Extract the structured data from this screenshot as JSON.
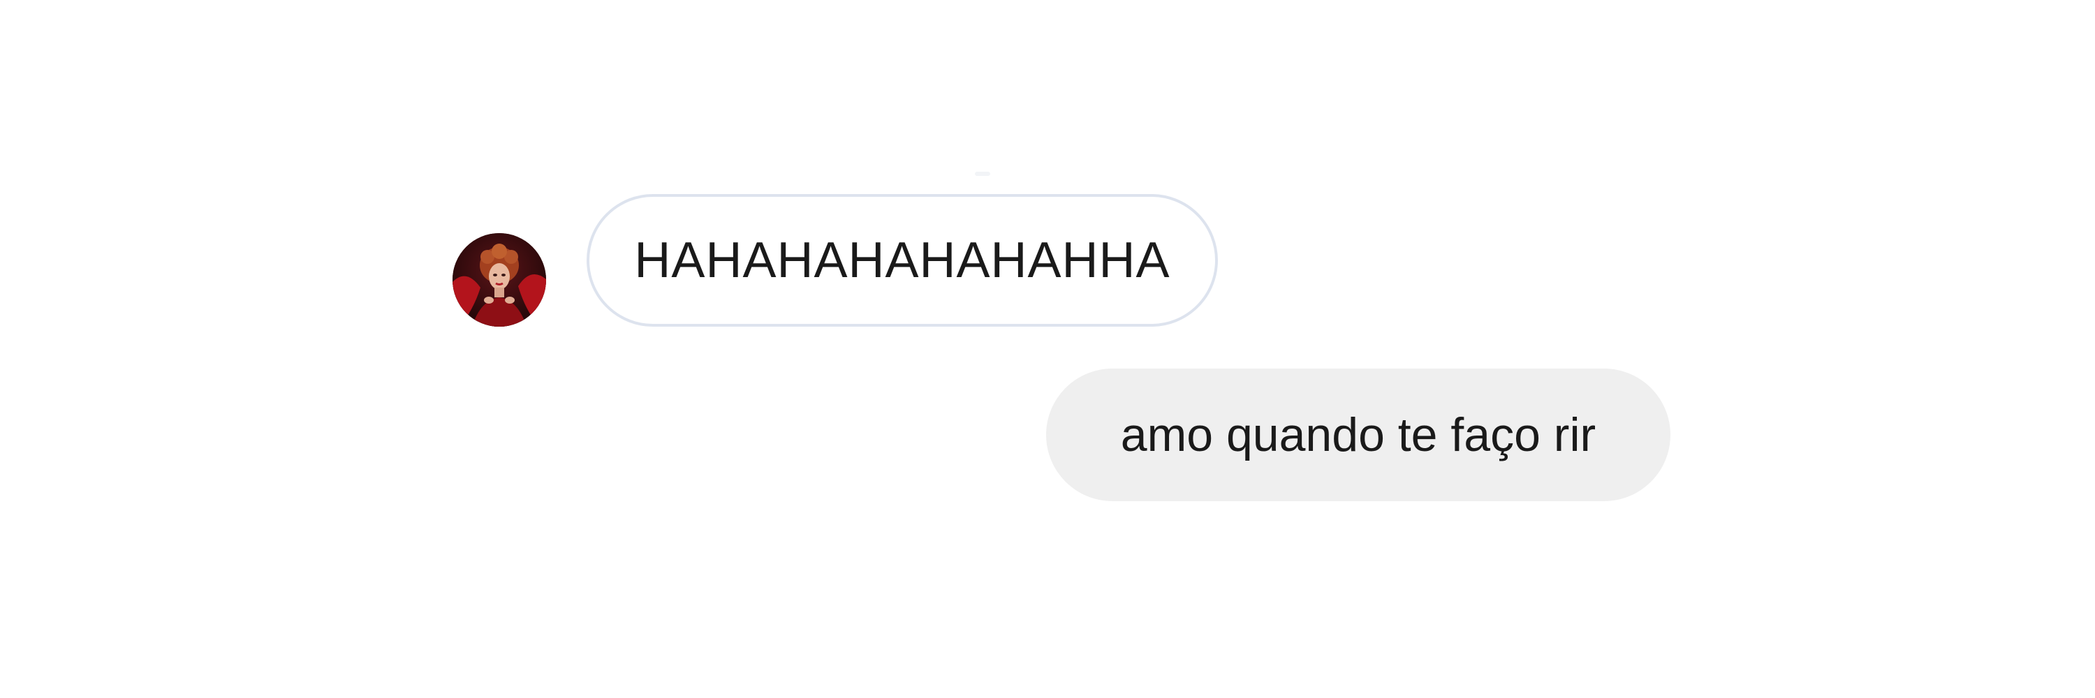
{
  "conversation": {
    "messages": [
      {
        "direction": "incoming",
        "text": "HAHAHAHAHAHAHHA",
        "has_avatar": true
      },
      {
        "direction": "outgoing",
        "text": "amo quando te faço rir"
      }
    ]
  },
  "colors": {
    "incoming_bubble_bg": "#ffffff",
    "incoming_bubble_border": "#dde3ee",
    "outgoing_bubble_bg": "#efefef",
    "text": "#1a1a1a",
    "page_bg": "#ffffff"
  },
  "icons": {
    "avatar": "user-avatar-photo"
  }
}
